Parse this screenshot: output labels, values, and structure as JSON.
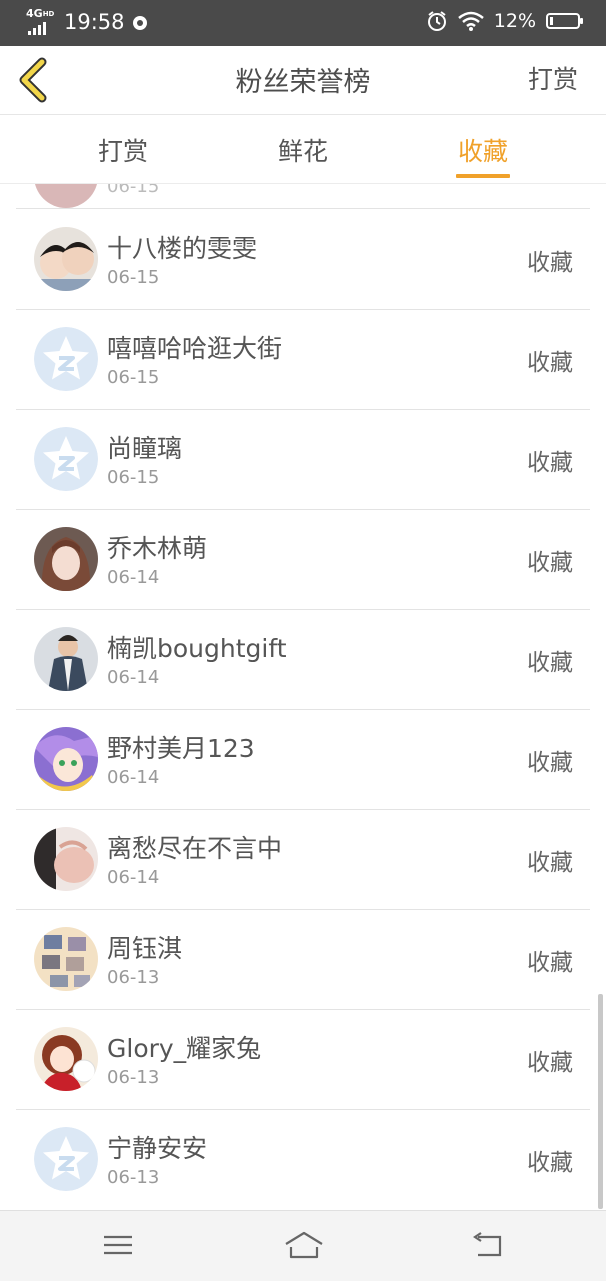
{
  "status_bar": {
    "network": "4G",
    "network_sub": "HD",
    "time": "19:58",
    "battery": "12%",
    "battery_level": 0.12
  },
  "nav": {
    "title": "粉丝荣誉榜",
    "right": "打赏"
  },
  "tabs": [
    {
      "label": "打赏",
      "active": false
    },
    {
      "label": "鲜花",
      "active": false
    },
    {
      "label": "收藏",
      "active": true
    }
  ],
  "partial_row": {
    "date": "06-15"
  },
  "rows": [
    {
      "name": "十八楼的雯雯",
      "date": "06-15",
      "action": "收藏",
      "avatar": "photo-children"
    },
    {
      "name": "嘻嘻哈哈逛大街",
      "date": "06-15",
      "action": "收藏",
      "avatar": "default-star"
    },
    {
      "name": "尚瞳璃",
      "date": "06-15",
      "action": "收藏",
      "avatar": "default-star"
    },
    {
      "name": "乔木林萌",
      "date": "06-14",
      "action": "收藏",
      "avatar": "photo-girl"
    },
    {
      "name": "楠凯boughtgift",
      "date": "06-14",
      "action": "收藏",
      "avatar": "photo-man"
    },
    {
      "name": "野村美月123",
      "date": "06-14",
      "action": "收藏",
      "avatar": "anime"
    },
    {
      "name": "离愁尽在不言中",
      "date": "06-14",
      "action": "收藏",
      "avatar": "photo-hand"
    },
    {
      "name": "周钰淇",
      "date": "06-13",
      "action": "收藏",
      "avatar": "photo-collage"
    },
    {
      "name": "Glory_耀家兔",
      "date": "06-13",
      "action": "收藏",
      "avatar": "cartoon-girl"
    },
    {
      "name": "宁静安安",
      "date": "06-13",
      "action": "收藏",
      "avatar": "default-star"
    }
  ],
  "colors": {
    "accent": "#f0a12a",
    "status_bar": "#4a4a4a",
    "divider": "#e3e3e3",
    "default_avatar": "#dce8f5"
  }
}
